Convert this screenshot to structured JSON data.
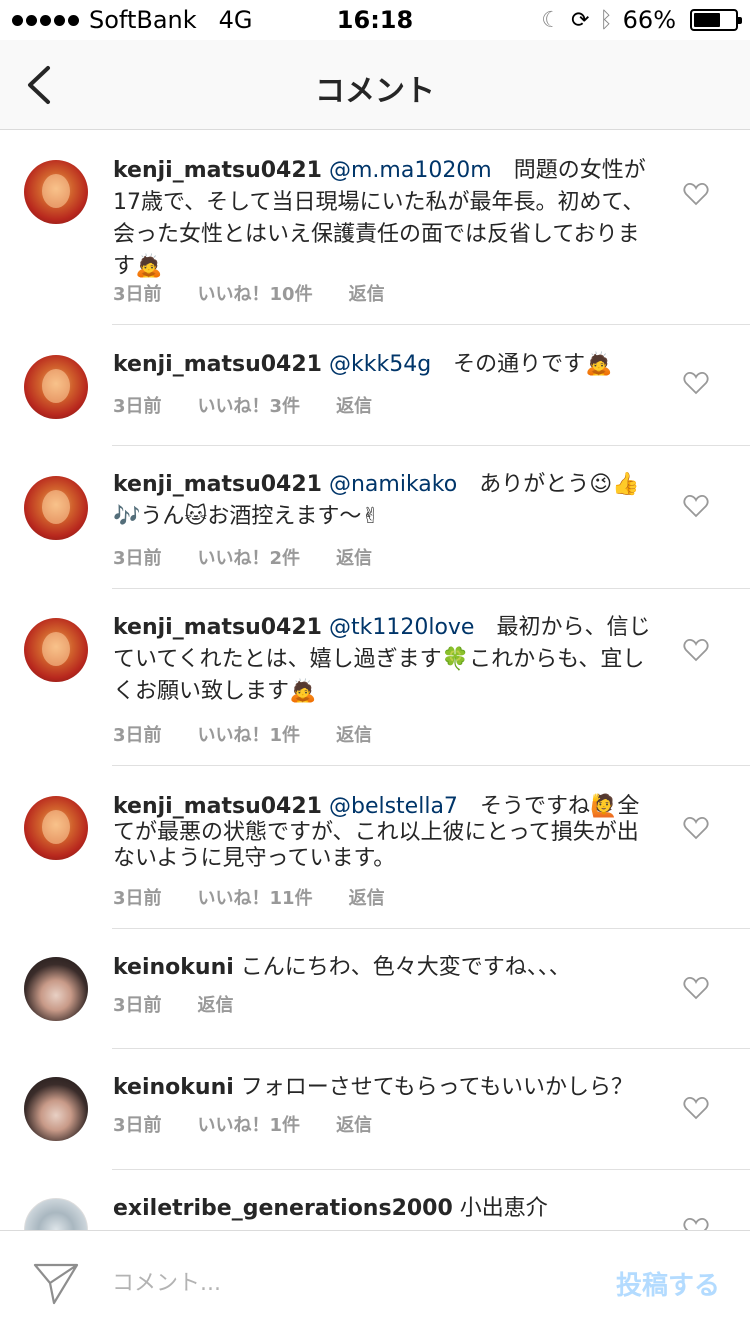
{
  "status_bar": {
    "carrier": "SoftBank",
    "network": "4G",
    "time": "16:18",
    "battery_percent": "66%",
    "battery_level": 0.66
  },
  "nav": {
    "title": "コメント"
  },
  "comments": [
    {
      "username": "kenji_matsu0421",
      "mention": "@m.ma1020m",
      "text": "　問題の女性が17歳で、そして当日現場にいた私が最年長。初めて、会った女性とはいえ保護責任の面では反省しております🙇",
      "time": "3日前",
      "likes": "いいね！10件",
      "reply": "返信"
    },
    {
      "username": "kenji_matsu0421",
      "mention": "@kkk54g",
      "text": "　その通りです🙇",
      "time": "3日前",
      "likes": "いいね！3件",
      "reply": "返信"
    },
    {
      "username": "kenji_matsu0421",
      "mention": "@namikako",
      "text": "　ありがとう😉👍🎶うん🐱お酒控えます〜✌",
      "time": "3日前",
      "likes": "いいね！2件",
      "reply": "返信"
    },
    {
      "username": "kenji_matsu0421",
      "mention": "@tk1120love",
      "text": "　最初から、信じていてくれたとは、嬉し過ぎます🍀これからも、宜しくお願い致します🙇",
      "time": "3日前",
      "likes": "いいね！1件",
      "reply": "返信"
    },
    {
      "username": "kenji_matsu0421",
      "mention": "@belstella7",
      "text": "　そうですね🙋全てが最悪の状態ですが、これ以上彼にとって損失が出ないように見守っています。",
      "time": "3日前",
      "likes": "いいね！11件",
      "reply": "返信"
    },
    {
      "username": "keinokuni",
      "mention": "",
      "text": "こんにちわ、色々大変ですね、、、",
      "time": "3日前",
      "likes": "",
      "reply": "返信"
    },
    {
      "username": "keinokuni",
      "mention": "",
      "text": "フォローさせてもらってもいいかしら？",
      "time": "3日前",
      "likes": "いいね！1件",
      "reply": "返信"
    },
    {
      "username": "exiletribe_generations2000",
      "mention": "",
      "text": "小出恵介",
      "time": "",
      "likes": "",
      "reply": ""
    }
  ],
  "composer": {
    "placeholder": "コメント...",
    "post_label": "投稿する"
  },
  "colors": {
    "mention": "#003569",
    "meta": "#999999",
    "post_disabled": "#b3dbff"
  },
  "icons": {
    "back": "chevron-left-icon",
    "like": "heart-outline-icon",
    "send": "paper-plane-icon"
  }
}
